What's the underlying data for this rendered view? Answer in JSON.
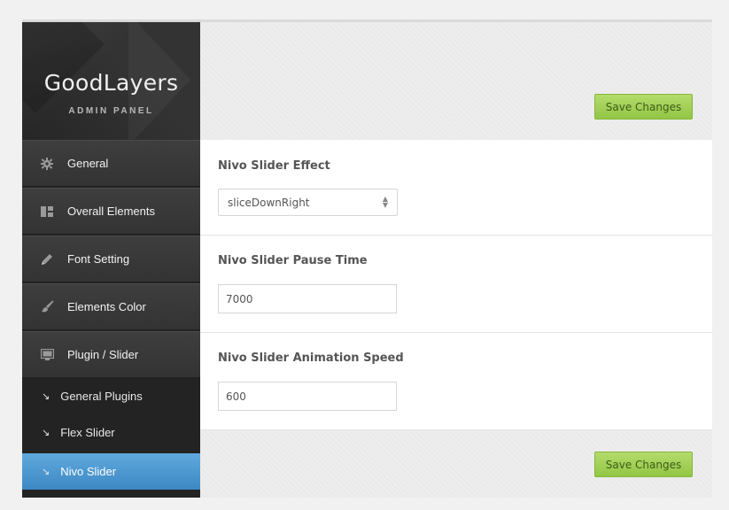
{
  "brand": {
    "title": "GoodLayers",
    "subtitle": "ADMIN PANEL"
  },
  "sidebar": {
    "items": [
      {
        "label": "General",
        "icon": "gear-icon"
      },
      {
        "label": "Overall Elements",
        "icon": "layout-icon"
      },
      {
        "label": "Font Setting",
        "icon": "pencil-icon"
      },
      {
        "label": "Elements Color",
        "icon": "brush-icon"
      },
      {
        "label": "Plugin / Slider",
        "icon": "monitor-icon"
      }
    ],
    "subitems": [
      {
        "label": "General Plugins",
        "active": false
      },
      {
        "label": "Flex Slider",
        "active": false
      },
      {
        "label": "Nivo Slider",
        "active": true
      }
    ],
    "arrow_glyph": "↘"
  },
  "toolbar": {
    "save_label": "Save Changes"
  },
  "form": {
    "effect": {
      "label": "Nivo Slider Effect",
      "value": "sliceDownRight"
    },
    "pause": {
      "label": "Nivo Slider Pause Time",
      "value": "7000"
    },
    "speed": {
      "label": "Nivo Slider Animation Speed",
      "value": "600"
    }
  },
  "colors": {
    "sidebar_bg": "#262626",
    "active_item": "#4a96d0",
    "save_button": "#a3d258"
  }
}
